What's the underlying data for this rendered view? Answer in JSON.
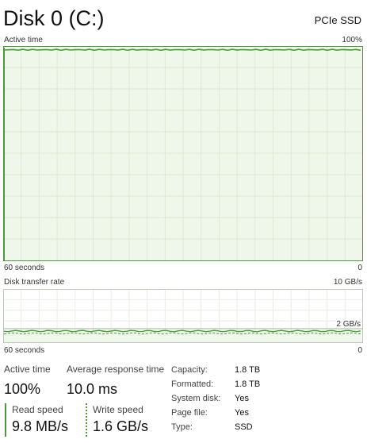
{
  "header": {
    "title": "Disk 0 (C:)",
    "drive_type": "PCIe SSD"
  },
  "active_time_graph": {
    "label": "Active time",
    "max_label": "100%",
    "time_span_label": "60 seconds",
    "min_label": "0",
    "value_percent": 100
  },
  "transfer_graph": {
    "label": "Disk transfer rate",
    "max_label": "10 GB/s",
    "secondary_label": "2 GB/s",
    "time_span_label": "60 seconds",
    "min_label": "0"
  },
  "stats": {
    "active_time_label": "Active time",
    "active_time_value": "100%",
    "avg_response_label": "Average response time",
    "avg_response_value": "10.0 ms",
    "read_speed_label": "Read speed",
    "read_speed_value": "9.8 MB/s",
    "write_speed_label": "Write speed",
    "write_speed_value": "1.6 GB/s"
  },
  "properties": [
    {
      "key": "Capacity:",
      "value": "1.8 TB"
    },
    {
      "key": "Formatted:",
      "value": "1.8 TB"
    },
    {
      "key": "System disk:",
      "value": "Yes"
    },
    {
      "key": "Page file:",
      "value": "Yes"
    },
    {
      "key": "Type:",
      "value": "SSD"
    }
  ],
  "colors": {
    "graph_line": "#4b9a3a",
    "graph_fill": "#eff7ea",
    "graph_grid": "#dce9d4"
  }
}
